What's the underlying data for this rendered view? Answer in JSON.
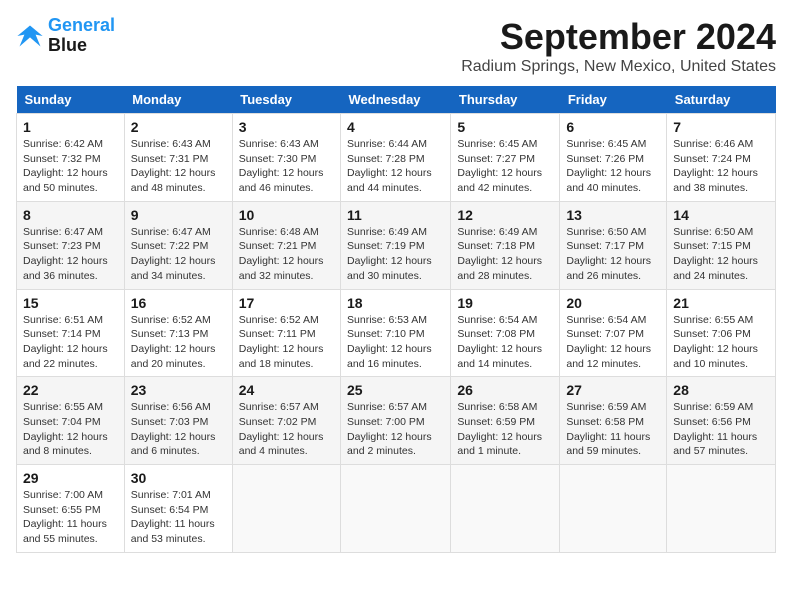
{
  "header": {
    "logo_line1": "General",
    "logo_line2": "Blue",
    "title": "September 2024",
    "subtitle": "Radium Springs, New Mexico, United States"
  },
  "days_of_week": [
    "Sunday",
    "Monday",
    "Tuesday",
    "Wednesday",
    "Thursday",
    "Friday",
    "Saturday"
  ],
  "weeks": [
    [
      {
        "day": "1",
        "sunrise": "6:42 AM",
        "sunset": "7:32 PM",
        "daylight": "12 hours and 50 minutes."
      },
      {
        "day": "2",
        "sunrise": "6:43 AM",
        "sunset": "7:31 PM",
        "daylight": "12 hours and 48 minutes."
      },
      {
        "day": "3",
        "sunrise": "6:43 AM",
        "sunset": "7:30 PM",
        "daylight": "12 hours and 46 minutes."
      },
      {
        "day": "4",
        "sunrise": "6:44 AM",
        "sunset": "7:28 PM",
        "daylight": "12 hours and 44 minutes."
      },
      {
        "day": "5",
        "sunrise": "6:45 AM",
        "sunset": "7:27 PM",
        "daylight": "12 hours and 42 minutes."
      },
      {
        "day": "6",
        "sunrise": "6:45 AM",
        "sunset": "7:26 PM",
        "daylight": "12 hours and 40 minutes."
      },
      {
        "day": "7",
        "sunrise": "6:46 AM",
        "sunset": "7:24 PM",
        "daylight": "12 hours and 38 minutes."
      }
    ],
    [
      {
        "day": "8",
        "sunrise": "6:47 AM",
        "sunset": "7:23 PM",
        "daylight": "12 hours and 36 minutes."
      },
      {
        "day": "9",
        "sunrise": "6:47 AM",
        "sunset": "7:22 PM",
        "daylight": "12 hours and 34 minutes."
      },
      {
        "day": "10",
        "sunrise": "6:48 AM",
        "sunset": "7:21 PM",
        "daylight": "12 hours and 32 minutes."
      },
      {
        "day": "11",
        "sunrise": "6:49 AM",
        "sunset": "7:19 PM",
        "daylight": "12 hours and 30 minutes."
      },
      {
        "day": "12",
        "sunrise": "6:49 AM",
        "sunset": "7:18 PM",
        "daylight": "12 hours and 28 minutes."
      },
      {
        "day": "13",
        "sunrise": "6:50 AM",
        "sunset": "7:17 PM",
        "daylight": "12 hours and 26 minutes."
      },
      {
        "day": "14",
        "sunrise": "6:50 AM",
        "sunset": "7:15 PM",
        "daylight": "12 hours and 24 minutes."
      }
    ],
    [
      {
        "day": "15",
        "sunrise": "6:51 AM",
        "sunset": "7:14 PM",
        "daylight": "12 hours and 22 minutes."
      },
      {
        "day": "16",
        "sunrise": "6:52 AM",
        "sunset": "7:13 PM",
        "daylight": "12 hours and 20 minutes."
      },
      {
        "day": "17",
        "sunrise": "6:52 AM",
        "sunset": "7:11 PM",
        "daylight": "12 hours and 18 minutes."
      },
      {
        "day": "18",
        "sunrise": "6:53 AM",
        "sunset": "7:10 PM",
        "daylight": "12 hours and 16 minutes."
      },
      {
        "day": "19",
        "sunrise": "6:54 AM",
        "sunset": "7:08 PM",
        "daylight": "12 hours and 14 minutes."
      },
      {
        "day": "20",
        "sunrise": "6:54 AM",
        "sunset": "7:07 PM",
        "daylight": "12 hours and 12 minutes."
      },
      {
        "day": "21",
        "sunrise": "6:55 AM",
        "sunset": "7:06 PM",
        "daylight": "12 hours and 10 minutes."
      }
    ],
    [
      {
        "day": "22",
        "sunrise": "6:55 AM",
        "sunset": "7:04 PM",
        "daylight": "12 hours and 8 minutes."
      },
      {
        "day": "23",
        "sunrise": "6:56 AM",
        "sunset": "7:03 PM",
        "daylight": "12 hours and 6 minutes."
      },
      {
        "day": "24",
        "sunrise": "6:57 AM",
        "sunset": "7:02 PM",
        "daylight": "12 hours and 4 minutes."
      },
      {
        "day": "25",
        "sunrise": "6:57 AM",
        "sunset": "7:00 PM",
        "daylight": "12 hours and 2 minutes."
      },
      {
        "day": "26",
        "sunrise": "6:58 AM",
        "sunset": "6:59 PM",
        "daylight": "12 hours and 1 minute."
      },
      {
        "day": "27",
        "sunrise": "6:59 AM",
        "sunset": "6:58 PM",
        "daylight": "11 hours and 59 minutes."
      },
      {
        "day": "28",
        "sunrise": "6:59 AM",
        "sunset": "6:56 PM",
        "daylight": "11 hours and 57 minutes."
      }
    ],
    [
      {
        "day": "29",
        "sunrise": "7:00 AM",
        "sunset": "6:55 PM",
        "daylight": "11 hours and 55 minutes."
      },
      {
        "day": "30",
        "sunrise": "7:01 AM",
        "sunset": "6:54 PM",
        "daylight": "11 hours and 53 minutes."
      },
      null,
      null,
      null,
      null,
      null
    ]
  ]
}
